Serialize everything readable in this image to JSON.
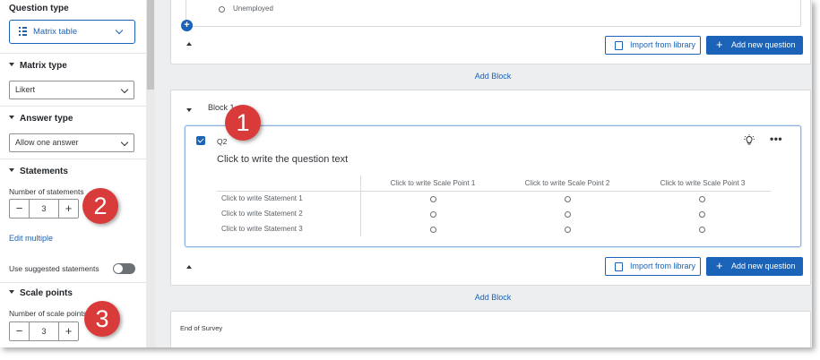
{
  "sidebar": {
    "question_type": {
      "title": "Question type",
      "value": "Matrix table"
    },
    "matrix_type": {
      "title": "Matrix type",
      "value": "Likert"
    },
    "answer_type": {
      "title": "Answer type",
      "value": "Allow one answer"
    },
    "statements": {
      "title": "Statements",
      "count_label": "Number of statements",
      "count": "3",
      "edit_multiple": "Edit multiple",
      "suggested_label": "Use suggested statements"
    },
    "scale_points": {
      "title": "Scale points",
      "count_label": "Number of scale points",
      "count": "3"
    }
  },
  "stepper": {
    "minus": "−",
    "plus": "+"
  },
  "top_block": {
    "option_label": "Unemployed",
    "import_label": "Import from library",
    "add_question_label": "Add new question",
    "add_block_label": "Add Block"
  },
  "block1": {
    "title": "Block 1",
    "question": {
      "id": "Q2",
      "text": "Click to write the question text",
      "scale_points": [
        "Click to write Scale Point 1",
        "Click to write Scale Point 2",
        "Click to write Scale Point 3"
      ],
      "statements": [
        "Click to write Statement 1",
        "Click to write Statement 2",
        "Click to write Statement 3"
      ]
    },
    "import_label": "Import from library",
    "add_question_label": "Add new question",
    "add_block_label": "Add Block"
  },
  "end_of_survey": {
    "title": "End of Survey"
  },
  "callouts": [
    "1",
    "2",
    "3"
  ],
  "icons": {
    "lightbulb": "lightbulb-icon",
    "more": "more-options-icon",
    "book": "book-icon",
    "matrix": "matrix-icon"
  },
  "colors": {
    "accent": "#1a63b8",
    "callout": "#d93a3a"
  }
}
